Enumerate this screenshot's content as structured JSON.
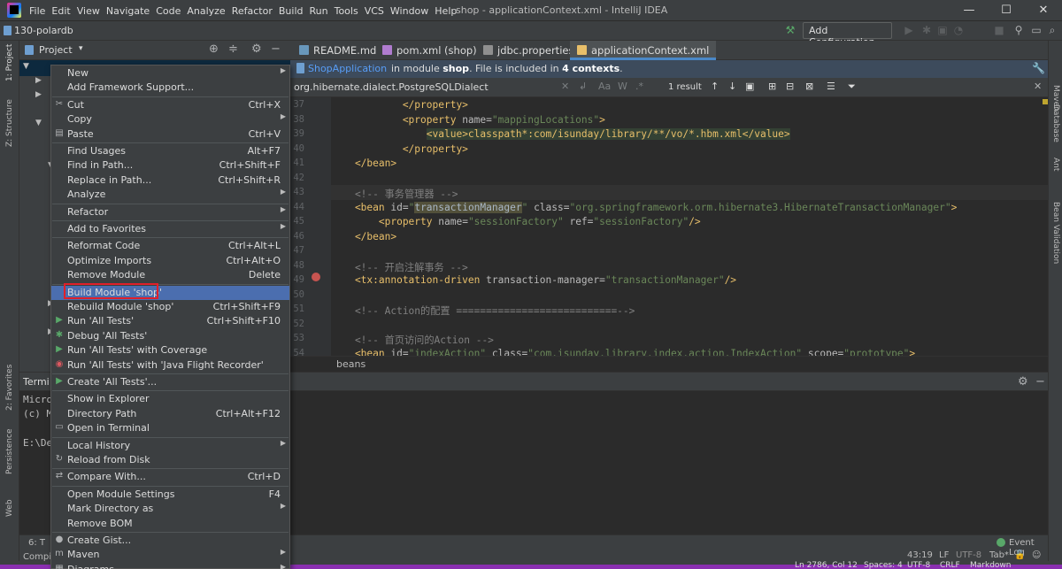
{
  "window": {
    "title": "shop - applicationContext.xml - IntelliJ IDEA",
    "menu": [
      "File",
      "Edit",
      "View",
      "Navigate",
      "Code",
      "Analyze",
      "Refactor",
      "Build",
      "Run",
      "Tools",
      "VCS",
      "Window",
      "Help"
    ],
    "minimize": "—",
    "maximize": "☐",
    "close": "✕"
  },
  "navbar": {
    "project_name": "130-polardb",
    "add_configuration": "Add Configuration..."
  },
  "left_stripe": {
    "project": "1: Project",
    "structure": "Z: Structure",
    "favorites": "2: Favorites",
    "persistence": "Persistence",
    "web": "Web"
  },
  "right_stripe": {
    "maven": "Maven",
    "database": "Database",
    "ant": "Ant",
    "bean_validation": "Bean Validation"
  },
  "project_panel": {
    "title": "Project"
  },
  "editor_tabs": [
    {
      "label": "README.md",
      "color": "#6897bb"
    },
    {
      "label": "pom.xml (shop)",
      "color": "#b07ccf"
    },
    {
      "label": "jdbc.properties",
      "color": "#8f8f8f"
    },
    {
      "label": "applicationContext.xml",
      "color": "#e8bf6a"
    }
  ],
  "notification": {
    "link": "ShopApplication",
    "text_prefix": "in module",
    "module": "shop",
    "text_mid": ". File is included in",
    "contexts": "4 contexts",
    "text_suffix": "."
  },
  "search": {
    "query": "org.hibernate.dialect.PostgreSQLDialect",
    "result": "1 result",
    "options": [
      "Aa",
      "W",
      ".*"
    ]
  },
  "code_lines": [
    {
      "n": "37",
      "parts": [
        [
          "t",
          "            </property>"
        ]
      ]
    },
    {
      "n": "38",
      "parts": [
        [
          "t",
          "            <property "
        ],
        [
          "a",
          "name="
        ],
        [
          "s",
          "\"mappingLocations\""
        ],
        [
          "t",
          ">"
        ]
      ]
    },
    {
      "n": "39",
      "parts": [
        [
          "t",
          "                "
        ],
        [
          "hl",
          "<value>classpath*:com/isunday/library/**/vo/*.hbm.xml</value>"
        ]
      ]
    },
    {
      "n": "40",
      "parts": [
        [
          "t",
          "            </property>"
        ]
      ]
    },
    {
      "n": "41",
      "parts": [
        [
          "t",
          "    </bean>"
        ]
      ]
    },
    {
      "n": "42",
      "parts": [
        [
          "t",
          ""
        ]
      ]
    },
    {
      "n": "43",
      "parts": [
        [
          "c",
          "    <!-- 事务管理器 -->"
        ]
      ]
    },
    {
      "n": "44",
      "parts": [
        [
          "t",
          "    <bean "
        ],
        [
          "a",
          "id="
        ],
        [
          "s",
          "\""
        ],
        [
          "hlw",
          "transactionManager"
        ],
        [
          "s",
          "\""
        ],
        [
          "a",
          " class="
        ],
        [
          "s",
          "\"org.springframework.orm.hibernate3.HibernateTransactionManager\""
        ],
        [
          "t",
          ">"
        ]
      ]
    },
    {
      "n": "45",
      "parts": [
        [
          "t",
          "        <property "
        ],
        [
          "a",
          "name="
        ],
        [
          "s",
          "\"sessionFactory\""
        ],
        [
          "a",
          " ref="
        ],
        [
          "s",
          "\"sessionFactory\""
        ],
        [
          "t",
          "/>"
        ]
      ]
    },
    {
      "n": "46",
      "parts": [
        [
          "t",
          "    </bean>"
        ]
      ]
    },
    {
      "n": "47",
      "parts": [
        [
          "t",
          ""
        ]
      ]
    },
    {
      "n": "48",
      "parts": [
        [
          "c",
          "    <!-- 开启注解事务 -->"
        ]
      ]
    },
    {
      "n": "49",
      "parts": [
        [
          "t",
          "    <tx:annotation-driven "
        ],
        [
          "a",
          "transaction-manager="
        ],
        [
          "s",
          "\"transactionManager\""
        ],
        [
          "t",
          "/>"
        ]
      ]
    },
    {
      "n": "50",
      "parts": [
        [
          "t",
          ""
        ]
      ]
    },
    {
      "n": "51",
      "parts": [
        [
          "c",
          "    <!-- Action的配置 ===========================-->"
        ]
      ]
    },
    {
      "n": "52",
      "parts": [
        [
          "t",
          ""
        ]
      ]
    },
    {
      "n": "53",
      "parts": [
        [
          "c",
          "    <!-- 首页访问的Action -->"
        ]
      ]
    },
    {
      "n": "54",
      "parts": [
        [
          "t",
          "    <bean "
        ],
        [
          "a",
          "id="
        ],
        [
          "s",
          "\"indexAction\""
        ],
        [
          "a",
          " class="
        ],
        [
          "s",
          "\"com.isunday.library.index.action.IndexAction\""
        ],
        [
          "a",
          " scope="
        ],
        [
          "s",
          "\"prototype\""
        ],
        [
          "t",
          ">"
        ]
      ]
    }
  ],
  "breadcrumb": "beans",
  "terminal": {
    "title": "Termi",
    "lines": [
      "Micro",
      "(c) M",
      "",
      "E:\\De"
    ]
  },
  "bottom_tools": {
    "todo": "6: T",
    "compile": "Compi",
    "event_log": "Event Log"
  },
  "status": {
    "position": "43:19",
    "line_sep": "LF",
    "encoding": "UTF-8",
    "indent": "Tab*",
    "bottom_line": "Ln 2786, Col 12",
    "spaces": "Spaces: 4",
    "enc2": "UTF-8",
    "crlf": "CRLF",
    "lang": "Markdown"
  },
  "context_menu": [
    {
      "label": "New",
      "arrow": true
    },
    {
      "label": "Add Framework Support..."
    },
    {
      "sep": true
    },
    {
      "label": "Cut",
      "shortcut": "Ctrl+X",
      "icon": "✂"
    },
    {
      "label": "Copy",
      "arrow": true
    },
    {
      "label": "Paste",
      "shortcut": "Ctrl+V",
      "icon": "▤"
    },
    {
      "sep": true
    },
    {
      "label": "Find Usages",
      "shortcut": "Alt+F7"
    },
    {
      "label": "Find in Path...",
      "shortcut": "Ctrl+Shift+F"
    },
    {
      "label": "Replace in Path...",
      "shortcut": "Ctrl+Shift+R"
    },
    {
      "label": "Analyze",
      "arrow": true
    },
    {
      "sep": true
    },
    {
      "label": "Refactor",
      "arrow": true
    },
    {
      "sep": true
    },
    {
      "label": "Add to Favorites",
      "arrow": true
    },
    {
      "sep": true
    },
    {
      "label": "Reformat Code",
      "shortcut": "Ctrl+Alt+L"
    },
    {
      "label": "Optimize Imports",
      "shortcut": "Ctrl+Alt+O"
    },
    {
      "label": "Remove Module",
      "shortcut": "Delete"
    },
    {
      "sep": true
    },
    {
      "label": "Build Module 'shop'",
      "selected": true
    },
    {
      "label": "Rebuild Module 'shop'",
      "shortcut": "Ctrl+Shift+F9"
    },
    {
      "label": "Run 'All Tests'",
      "shortcut": "Ctrl+Shift+F10",
      "icon": "▶",
      "iconColor": "#59a869"
    },
    {
      "label": "Debug 'All Tests'",
      "icon": "✱",
      "iconColor": "#59a869"
    },
    {
      "label": "Run 'All Tests' with Coverage",
      "icon": "▶",
      "iconColor": "#59a869"
    },
    {
      "label": "Run 'All Tests' with 'Java Flight Recorder'",
      "icon": "◉",
      "iconColor": "#db5860"
    },
    {
      "sep": true
    },
    {
      "label": "Create 'All Tests'...",
      "icon": "▶",
      "iconColor": "#59a869"
    },
    {
      "sep": true
    },
    {
      "label": "Show in Explorer"
    },
    {
      "label": "Directory Path",
      "shortcut": "Ctrl+Alt+F12"
    },
    {
      "label": "Open in Terminal",
      "icon": "▭"
    },
    {
      "sep": true
    },
    {
      "label": "Local History",
      "arrow": true
    },
    {
      "label": "Reload from Disk",
      "icon": "↻"
    },
    {
      "sep": true
    },
    {
      "label": "Compare With...",
      "shortcut": "Ctrl+D",
      "icon": "⇄"
    },
    {
      "sep": true
    },
    {
      "label": "Open Module Settings",
      "shortcut": "F4"
    },
    {
      "label": "Mark Directory as",
      "arrow": true
    },
    {
      "label": "Remove BOM"
    },
    {
      "sep": true
    },
    {
      "label": "Create Gist...",
      "icon": "●"
    },
    {
      "label": "Maven",
      "arrow": true,
      "icon": "m"
    },
    {
      "label": "Diagrams",
      "arrow": true,
      "icon": "▦"
    }
  ]
}
